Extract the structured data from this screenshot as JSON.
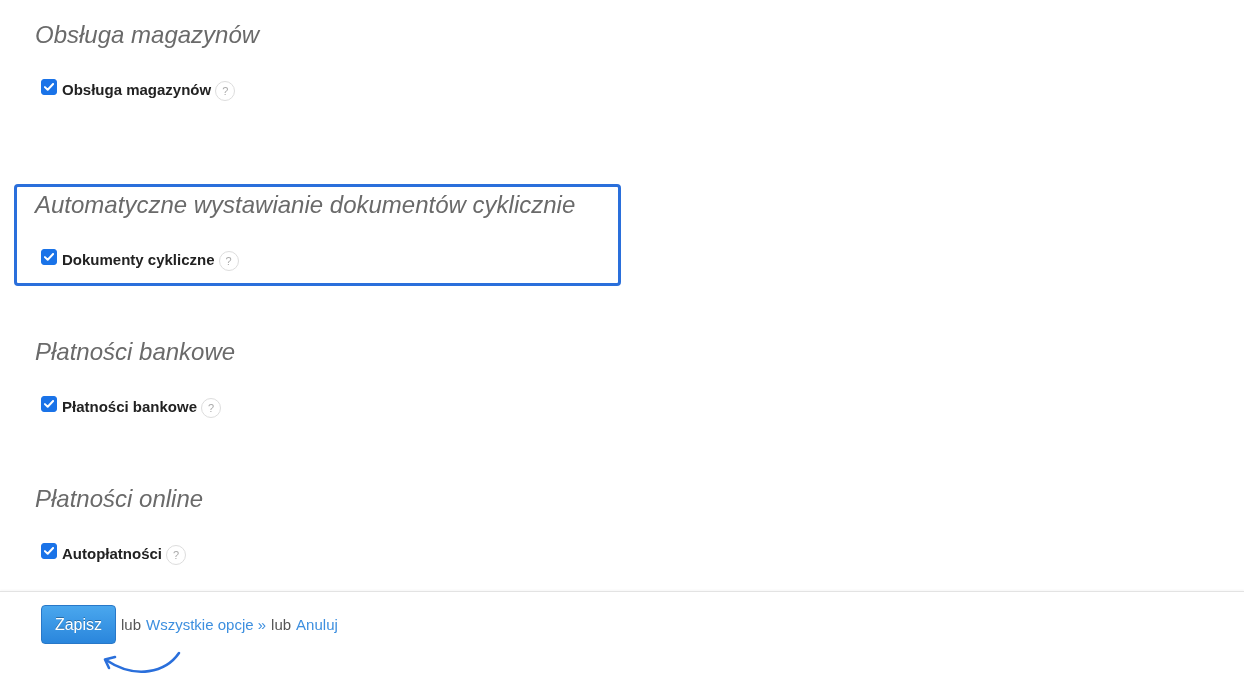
{
  "sections": [
    {
      "title": "Obsługa magazynów",
      "highlighted": false,
      "options": [
        {
          "label": "Obsługa magazynów",
          "checked": true,
          "help": "?"
        }
      ]
    },
    {
      "title": "Automatyczne wystawianie dokumentów cyklicznie",
      "highlighted": true,
      "options": [
        {
          "label": "Dokumenty cykliczne",
          "checked": true,
          "help": "?"
        }
      ]
    },
    {
      "title": "Płatności bankowe",
      "highlighted": false,
      "options": [
        {
          "label": "Płatności bankowe",
          "checked": true,
          "help": "?"
        }
      ]
    },
    {
      "title": "Płatności online",
      "highlighted": false,
      "options": [
        {
          "label": "Autopłatności",
          "checked": true,
          "help": "?"
        }
      ]
    }
  ],
  "footer": {
    "save_button": "Zapisz",
    "items": [
      {
        "kind": "text",
        "text": "lub"
      },
      {
        "kind": "link",
        "text": "Wszystkie opcje »"
      },
      {
        "kind": "text",
        "text": "lub"
      },
      {
        "kind": "link",
        "text": "Anuluj"
      }
    ]
  }
}
